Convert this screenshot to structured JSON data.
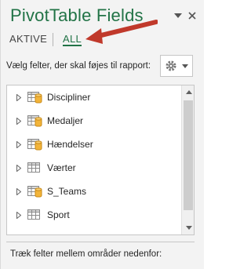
{
  "pane": {
    "title": "PivotTable Fields",
    "tabs": [
      {
        "label": "AKTIVE",
        "selected": false
      },
      {
        "label": "ALL",
        "selected": true
      }
    ],
    "choose_label": "Vælg felter, der skal føjes til rapport:",
    "drag_label": "Træk felter mellem områder nedenfor:"
  },
  "fields": [
    {
      "label": "Discipliner",
      "icon": "table-with-cylinder-icon",
      "expanded": false
    },
    {
      "label": "Medaljer",
      "icon": "table-with-cylinder-icon",
      "expanded": false
    },
    {
      "label": "Hændelser",
      "icon": "table-with-cylinder-icon",
      "expanded": false
    },
    {
      "label": "Værter",
      "icon": "table-icon",
      "expanded": false
    },
    {
      "label": "S_Teams",
      "icon": "table-with-cylinder-icon",
      "expanded": false
    },
    {
      "label": "Sport",
      "icon": "table-icon",
      "expanded": false
    }
  ],
  "colors": {
    "accent": "#217346",
    "annotation_arrow": "#c0392b"
  }
}
